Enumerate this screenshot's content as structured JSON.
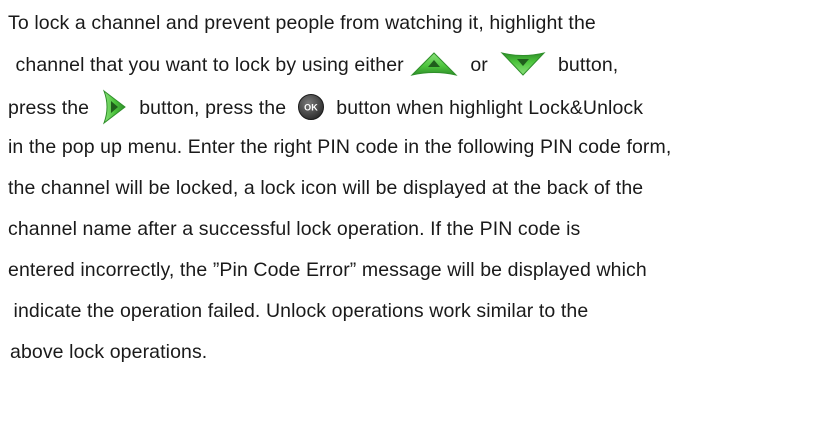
{
  "document": {
    "lines": [
      "To lock a channel and prevent people from watching it, highlight the",
      " channel that you want to lock by using either",
      " or ",
      " button,",
      "press the ",
      " button, press the ",
      " button when highlight Lock&Unlock",
      "in the pop up menu. Enter the right PIN code in the following PIN code form,",
      "the channel will be locked, a lock icon will be displayed at the back of the",
      "channel name after a successful lock operation. If the PIN code is",
      "entered incorrectly, the ”Pin Code Error” message will be displayed which",
      " indicate the operation failed. Unlock operations work similar to the",
      "above lock operations."
    ],
    "icons": {
      "up_button": "up-arrow-button-icon",
      "down_button": "down-arrow-button-icon",
      "right_button": "right-arrow-button-icon",
      "ok_button": "ok-button-icon",
      "ok_label": "OK"
    },
    "colors": {
      "arrow_green": "#4cc43c",
      "arrow_dark_green": "#2f8f2a",
      "ok_dark": "#3a3a3a"
    }
  }
}
